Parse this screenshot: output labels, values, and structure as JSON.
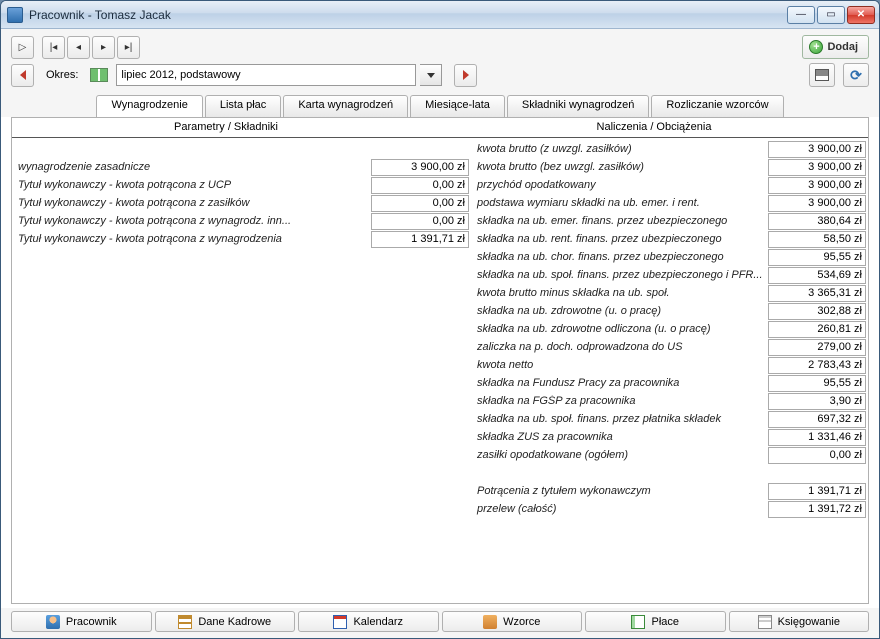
{
  "window": {
    "title": "Pracownik - Tomasz Jacak"
  },
  "toolbar": {
    "dodaj": "Dodaj"
  },
  "period": {
    "label": "Okres:",
    "value": "lipiec 2012, podstawowy"
  },
  "tabs": {
    "t0": "Wynagrodzenie",
    "t1": "Lista płac",
    "t2": "Karta wynagrodzeń",
    "t3": "Miesiące-lata",
    "t4": "Składniki wynagrodzeń",
    "t5": "Rozliczanie wzorców"
  },
  "headers": {
    "left": "Parametry / Składniki",
    "right": "Naliczenia / Obciążenia"
  },
  "left": [
    {
      "label": "wynagrodzenie zasadnicze",
      "value": "3 900,00 zł"
    },
    {
      "label": "Tytuł wykonawczy - kwota potrącona z UCP",
      "value": "0,00 zł"
    },
    {
      "label": "Tytuł wykonawczy - kwota potrącona z zasiłków",
      "value": "0,00 zł"
    },
    {
      "label": "Tytuł wykonawczy - kwota potrącona z wynagrodz. inn...",
      "value": "0,00 zł"
    },
    {
      "label": "Tytuł wykonawczy - kwota potrącona z wynagrodzenia",
      "value": "1 391,71 zł"
    }
  ],
  "right": [
    {
      "label": "kwota brutto (z uwzgl. zasiłków)",
      "value": "3 900,00 zł"
    },
    {
      "label": "kwota brutto (bez uwzgl. zasiłków)",
      "value": "3 900,00 zł"
    },
    {
      "label": "przychód opodatkowany",
      "value": "3 900,00 zł"
    },
    {
      "label": "podstawa wymiaru składki na ub. emer. i rent.",
      "value": "3 900,00 zł"
    },
    {
      "label": "składka na ub. emer. finans. przez ubezpieczonego",
      "value": "380,64 zł"
    },
    {
      "label": "składka na ub. rent. finans. przez ubezpieczonego",
      "value": "58,50 zł"
    },
    {
      "label": "składka na ub. chor. finans. przez ubezpieczonego",
      "value": "95,55 zł"
    },
    {
      "label": "składka na ub. społ. finans. przez ubezpieczonego i PFR...",
      "value": "534,69 zł"
    },
    {
      "label": "kwota brutto minus składka na ub. społ.",
      "value": "3 365,31 zł"
    },
    {
      "label": "składka na ub. zdrowotne (u. o pracę)",
      "value": "302,88 zł"
    },
    {
      "label": "składka na ub. zdrowotne odliczona (u. o pracę)",
      "value": "260,81 zł"
    },
    {
      "label": "zaliczka na p. doch. odprowadzona do US",
      "value": "279,00 zł"
    },
    {
      "label": "kwota netto",
      "value": "2 783,43 zł"
    },
    {
      "label": "składka na Fundusz Pracy za pracownika",
      "value": "95,55 zł"
    },
    {
      "label": "składka na FGŚP za pracownika",
      "value": "3,90 zł"
    },
    {
      "label": "składka na ub. społ. finans. przez płatnika składek",
      "value": "697,32 zł"
    },
    {
      "label": "składka ZUS za pracownika",
      "value": "1 331,46 zł"
    },
    {
      "label": "zasiłki opodatkowane (ogółem)",
      "value": "0,00 zł"
    }
  ],
  "rightExtra": [
    {
      "label": "Potrącenia z tytułem wykonawczym",
      "value": "1 391,71 zł"
    },
    {
      "label": "przelew (całość)",
      "value": "1 391,72 zł"
    }
  ],
  "bottom": {
    "b0": "Pracownik",
    "b1": "Dane Kadrowe",
    "b2": "Kalendarz",
    "b3": "Wzorce",
    "b4": "Płace",
    "b5": "Księgowanie"
  }
}
